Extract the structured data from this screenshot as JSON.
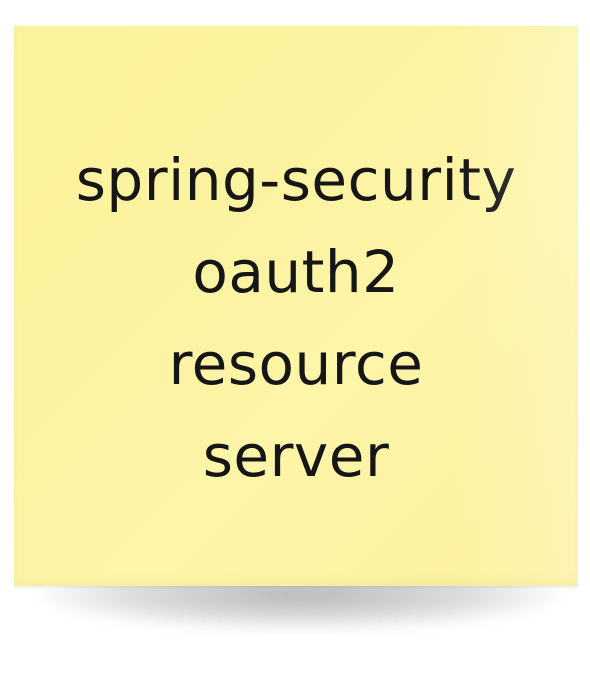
{
  "note": {
    "lines": [
      "spring-security",
      "oauth2",
      "resource",
      "server"
    ],
    "color": "#fcf3a1",
    "text_color": "#161616"
  }
}
